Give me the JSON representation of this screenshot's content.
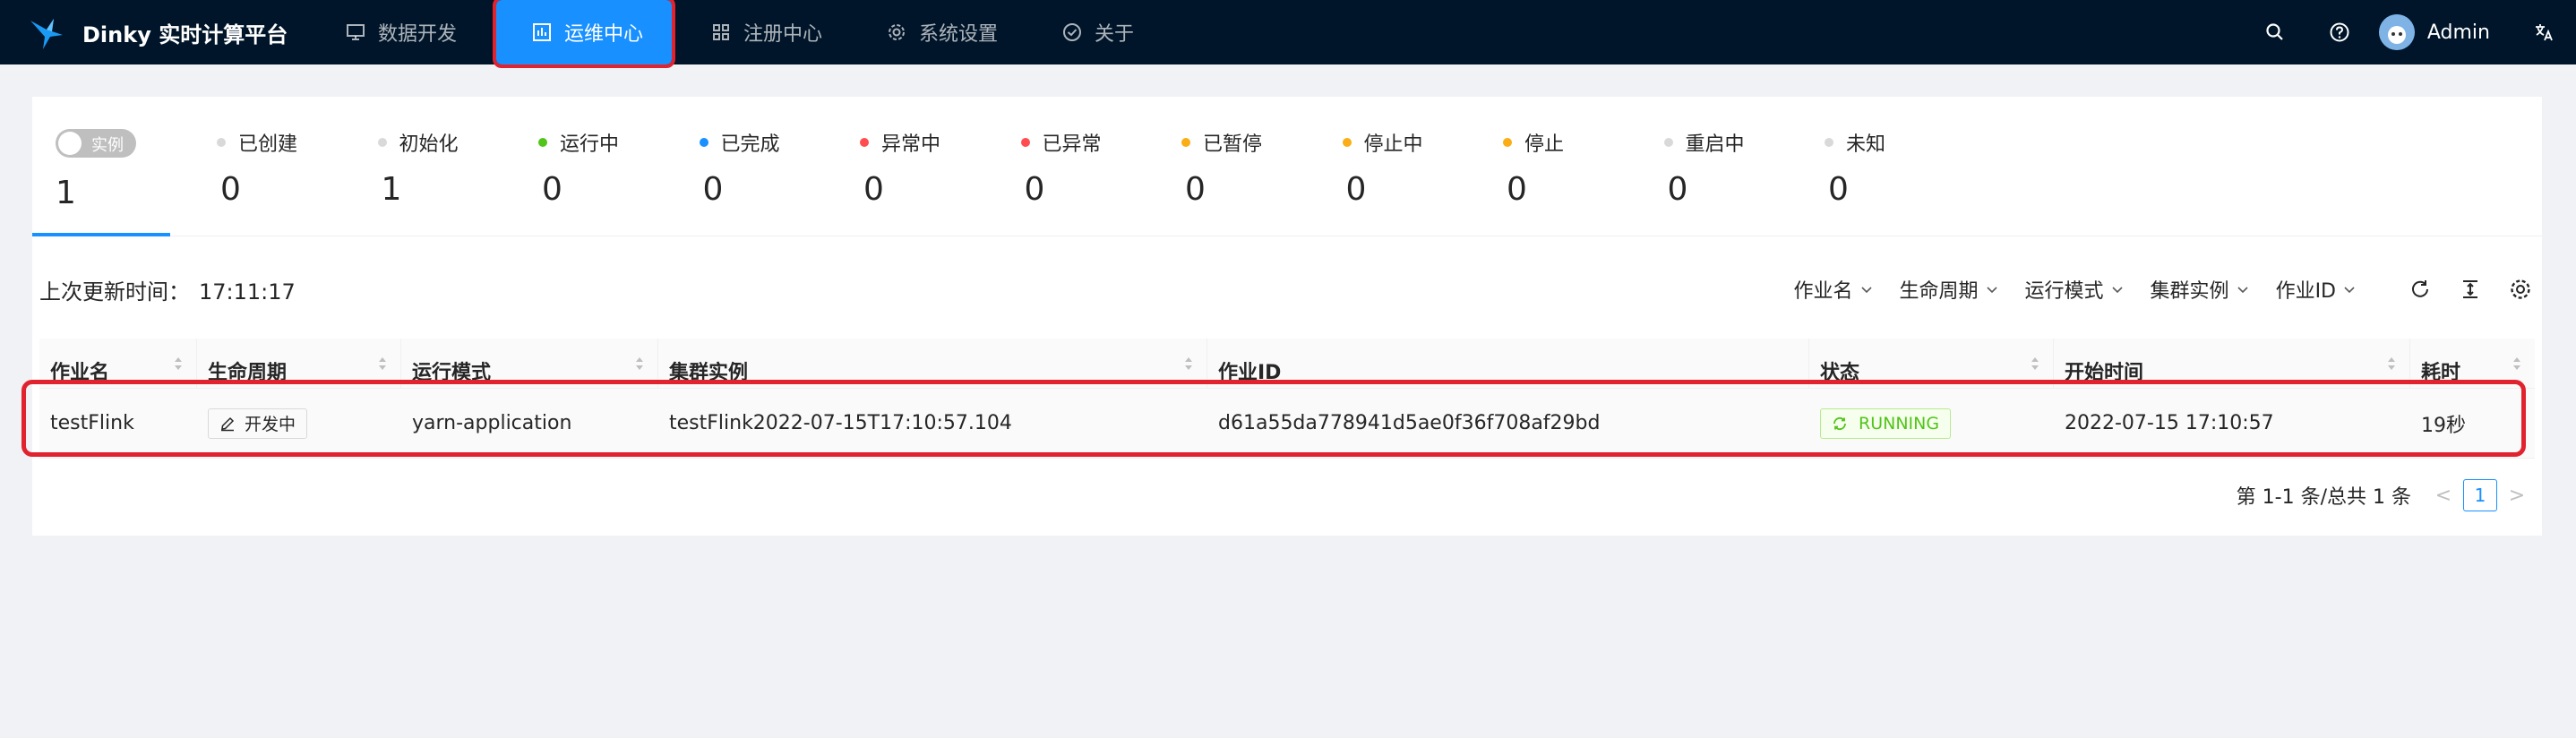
{
  "app": {
    "title": "Dinky 实时计算平台"
  },
  "nav": [
    {
      "label": "数据开发",
      "icon": "monitor-icon"
    },
    {
      "label": "运维中心",
      "icon": "dashboard-icon",
      "active": true
    },
    {
      "label": "注册中心",
      "icon": "appstore-icon"
    },
    {
      "label": "系统设置",
      "icon": "gear-icon"
    },
    {
      "label": "关于",
      "icon": "check-circle-icon"
    }
  ],
  "header": {
    "user": "Admin"
  },
  "stats": {
    "toggle_label": "实例",
    "total": "1",
    "items": [
      {
        "label": "已创建",
        "value": "0",
        "color": "#d9d9d9"
      },
      {
        "label": "初始化",
        "value": "1",
        "color": "#d9d9d9"
      },
      {
        "label": "运行中",
        "value": "0",
        "color": "#52c41a"
      },
      {
        "label": "已完成",
        "value": "0",
        "color": "#1890ff"
      },
      {
        "label": "异常中",
        "value": "0",
        "color": "#ff4d4f"
      },
      {
        "label": "已异常",
        "value": "0",
        "color": "#ff4d4f"
      },
      {
        "label": "已暂停",
        "value": "0",
        "color": "#faad14"
      },
      {
        "label": "停止中",
        "value": "0",
        "color": "#faad14"
      },
      {
        "label": "停止",
        "value": "0",
        "color": "#faad14"
      },
      {
        "label": "重启中",
        "value": "0",
        "color": "#d9d9d9"
      },
      {
        "label": "未知",
        "value": "0",
        "color": "#d9d9d9"
      }
    ]
  },
  "toolbar": {
    "last_update_label": "上次更新时间：",
    "last_update_time": "17:11:17",
    "filters": [
      "作业名",
      "生命周期",
      "运行模式",
      "集群实例",
      "作业ID"
    ]
  },
  "table": {
    "columns": [
      "作业名",
      "生命周期",
      "运行模式",
      "集群实例",
      "作业ID",
      "状态",
      "开始时间",
      "耗时"
    ],
    "rows": [
      {
        "name": "testFlink",
        "lifecycle": "开发中",
        "mode": "yarn-application",
        "cluster": "testFlink2022-07-15T17:10:57.104",
        "job_id": "d61a55da778941d5ae0f36f708af29bd",
        "status": "RUNNING",
        "start_time": "2022-07-15 17:10:57",
        "duration": "19秒"
      }
    ]
  },
  "pagination": {
    "total_text": "第 1-1 条/总共 1 条",
    "current": "1",
    "prev": "<",
    "next": ">"
  }
}
